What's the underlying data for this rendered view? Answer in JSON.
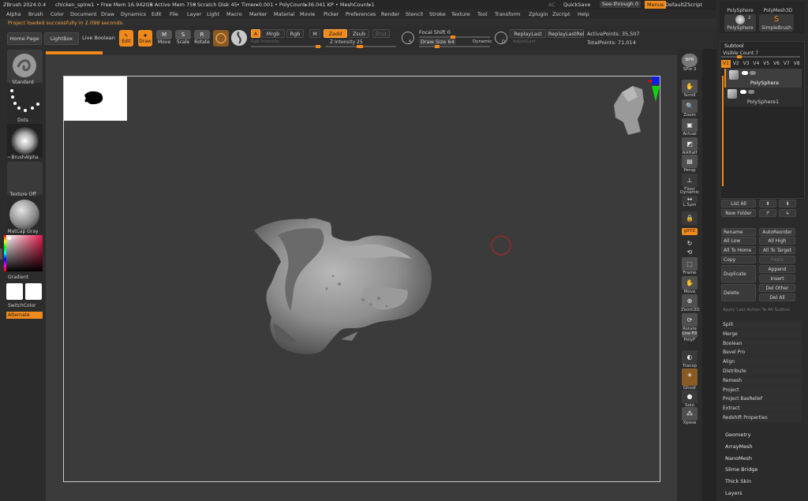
{
  "titlebar": {
    "app": "ZBrush 2024.0.4",
    "doc": "chicken_spine1",
    "free_mem": "• Free Mem 16.942GB",
    "active_mem": "• Active Mem 759",
    "scratch": "• Scratch Disk 45",
    "timer": "• Timer▸0.001",
    "polycount": "• PolyCount▸36.041 KP",
    "meshcount": "• MeshCount▸1",
    "ac": "AC",
    "quicksave": "QuickSave",
    "seethrough": "See-through",
    "seethrough_val": "0",
    "menus": "Menus",
    "zscript": "DefaultZScript"
  },
  "menubar": [
    "Alpha",
    "Brush",
    "Color",
    "Document",
    "Draw",
    "Dynamics",
    "Edit",
    "File",
    "Layer",
    "Light",
    "Macro",
    "Marker",
    "Material",
    "Movie",
    "Picker",
    "Preferences",
    "Render",
    "Stencil",
    "Stroke",
    "Texture",
    "Tool",
    "Transform",
    "Zplugin",
    "Zscript",
    "Help"
  ],
  "status": "Project loaded successfully in 2.098 seconds.",
  "toolbar": {
    "home": "Home Page",
    "lightbox": "LightBox",
    "liveboolean": "Live Boolean",
    "edit": "Edit",
    "draw": "Draw",
    "move": "Move",
    "scale": "Scale",
    "rotate": "Rotate",
    "a": "A",
    "mrgb": "Mrgb",
    "rgb": "Rgb",
    "m": "M",
    "zadd": "Zadd",
    "zsub": "Zsub",
    "zcut": "Zcut",
    "rgb_intensity": "Rgb Intensity",
    "z_intensity": "Z Intensity 25",
    "s": "S",
    "focal_shift": "Focal Shift 0",
    "draw_size": "Draw Size 64",
    "dynamic": "Dynamic",
    "d": "D",
    "replaylast": "ReplayLast",
    "replaylastrel": "ReplayLastRel",
    "adjustlast": "AdjustLast",
    "activepoints": "ActivePoints: 35,507",
    "totalpoints": "TotalPoints: 71,014"
  },
  "leftshelf": {
    "standard": "Standard",
    "dots": "Dots",
    "brushalpha": "~BrushAlpha",
    "textureoff": "Texture Off",
    "matcap": "MatCap Gray",
    "gradient": "Gradient",
    "switchcolor": "SwitchColor",
    "alternate": "Alternate"
  },
  "rightshelf": {
    "bpr": "BPR",
    "spix": "SPix 3",
    "scroll": "Scroll",
    "zoom": "Zoom",
    "actual": "Actual",
    "aahalf": "AAHalf",
    "persp": "Persp",
    "floor": "Floor",
    "dynamic": "Dynamic",
    "lsym": "L.Sym",
    "xyz": "gXYZ",
    "frame": "Frame",
    "move": "Move",
    "zoom3d": "Zoom3D",
    "rotate": "Rotate",
    "lineFill": "Line Fill",
    "polyf": "PolyF",
    "transp": "Transp",
    "ghost": "Ghost",
    "solo": "Solo",
    "xpose": "Xpose"
  },
  "panel": {
    "tool1": "PolySphere",
    "tool2": "PolyMesh3D",
    "tool3": "PolySphere",
    "tool3_count": "2",
    "tool4": "SimpleBrush",
    "subtool_title": "Subtool",
    "visible_count": "Visible Count 7",
    "versions": [
      "V1",
      "V2",
      "V3",
      "V4",
      "V5",
      "V6",
      "V7",
      "V8"
    ],
    "subtools": [
      "PolySphere",
      "PolySphere1"
    ],
    "list_all": "List All",
    "new_folder": "New Folder",
    "rename": "Rename",
    "autoreorder": "AutoReorder",
    "all_low": "All Low",
    "all_high": "All High",
    "all_to_home": "All To Home",
    "all_to_target": "All To Target",
    "copy": "Copy",
    "paste": "Paste",
    "duplicate": "Duplicate",
    "append": "Append",
    "insert": "Insert",
    "delete": "Delete",
    "del_other": "Del Other",
    "del_all": "Del All",
    "apply_last": "Apply Last Action To All Subtoo",
    "list": [
      "Split",
      "Merge",
      "Boolean",
      "Bevel Pro",
      "Align",
      "Distribute",
      "Remesh",
      "Project",
      "Project BasRelief",
      "Extract",
      "Redshift Properties"
    ],
    "bottom": [
      "Geometry",
      "ArrayMesh",
      "NanoMesh",
      "Slime Bridge",
      "Thick Skin",
      "Layers"
    ]
  }
}
